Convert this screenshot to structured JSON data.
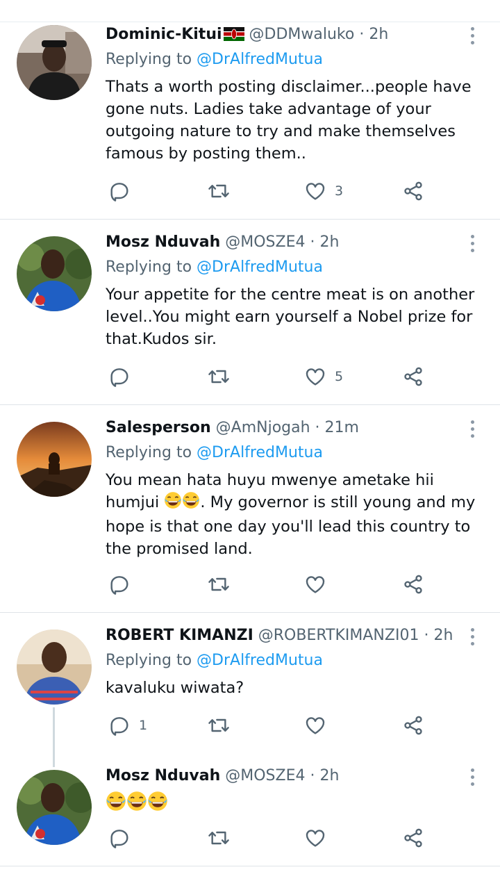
{
  "tweets": [
    {
      "name": "Dominic-Kitui",
      "handle": "@DDMwaluko",
      "time": "2h",
      "replying_label": "Replying to",
      "replying_to": "@DrAlfredMutua",
      "text": "Thats a worth posting disclaimer...people have gone nuts. Ladies take advantage of your outgoing nature to try and make themselves famous by posting them..",
      "reply_count": "",
      "like_count": "3",
      "avatar_icon": "profile-photo",
      "flag_icon": "kenya-flag-icon"
    },
    {
      "name": "Mosz Nduvah",
      "handle": "@MOSZE4",
      "time": "2h",
      "replying_label": "Replying to",
      "replying_to": "@DrAlfredMutua",
      "text": "Your appetite for the centre meat is on another level..You might earn yourself a Nobel prize for that.Kudos sir.",
      "reply_count": "",
      "like_count": "5",
      "avatar_icon": "profile-photo"
    },
    {
      "name": "Salesperson",
      "handle": "@AmNjogah",
      "time": "21m",
      "replying_label": "Replying to",
      "replying_to": "@DrAlfredMutua",
      "text_before_emoji": "You mean hata huyu mwenye ametake hii humjui",
      "text_after_emoji": ". My governor is still young and my hope is that one day you'll lead this country to the promised land.",
      "emoji_icon": "tears-of-joy-emoji",
      "reply_count": "",
      "like_count": "",
      "avatar_icon": "lion-photo"
    },
    {
      "name": "ROBERT KIMANZI",
      "handle": "@ROBERTKIMANZI01",
      "time": "2h",
      "replying_label": "Replying to",
      "replying_to": "@DrAlfredMutua",
      "text": "kavaluku wiwata?",
      "reply_count": "1",
      "like_count": "",
      "avatar_icon": "profile-photo"
    },
    {
      "name": "Mosz Nduvah",
      "handle": "@MOSZE4",
      "time": "2h",
      "emoji_icon": "tears-of-joy-emoji",
      "reply_count": "",
      "like_count": "",
      "avatar_icon": "profile-photo"
    }
  ],
  "colors": {
    "text": "#0f1419",
    "secondary": "#536471",
    "link": "#1d9bf0",
    "separator": "#dfe4e8"
  },
  "icons": {
    "reply": "reply-icon",
    "retweet": "retweet-icon",
    "like": "heart-icon",
    "share": "share-icon",
    "more": "more-vertical-icon"
  }
}
